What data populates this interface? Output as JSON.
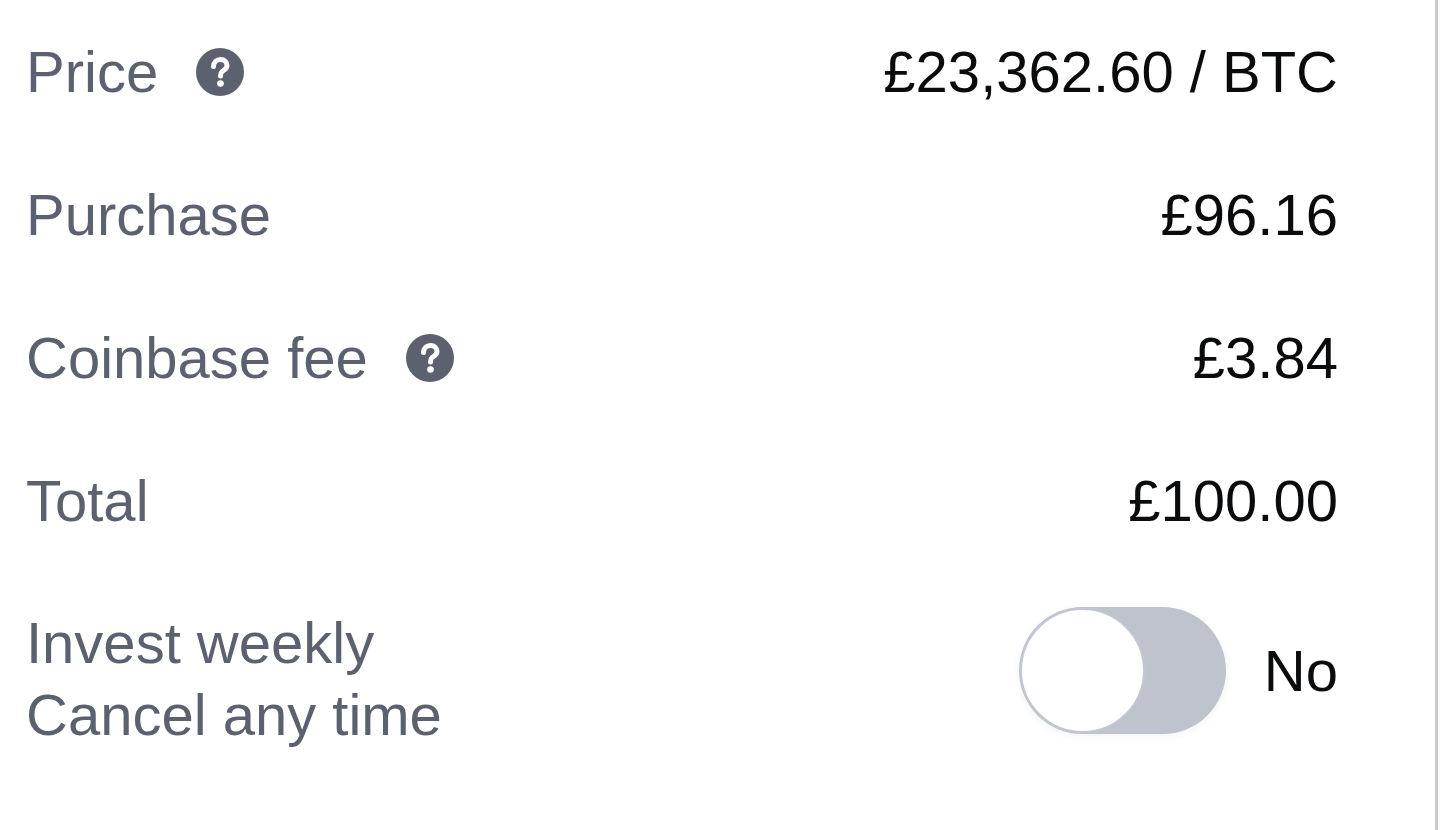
{
  "rows": [
    {
      "label": "Price",
      "help": true,
      "value": "£23,362.60 / BTC"
    },
    {
      "label": "Purchase",
      "help": false,
      "value": "£96.16"
    },
    {
      "label": "Coinbase fee",
      "help": true,
      "value": "£3.84"
    },
    {
      "label": "Total",
      "help": false,
      "value": "£100.00"
    }
  ],
  "invest": {
    "label": "Invest weekly",
    "sublabel": "Cancel any time",
    "on": false,
    "toggle_label": "No"
  }
}
